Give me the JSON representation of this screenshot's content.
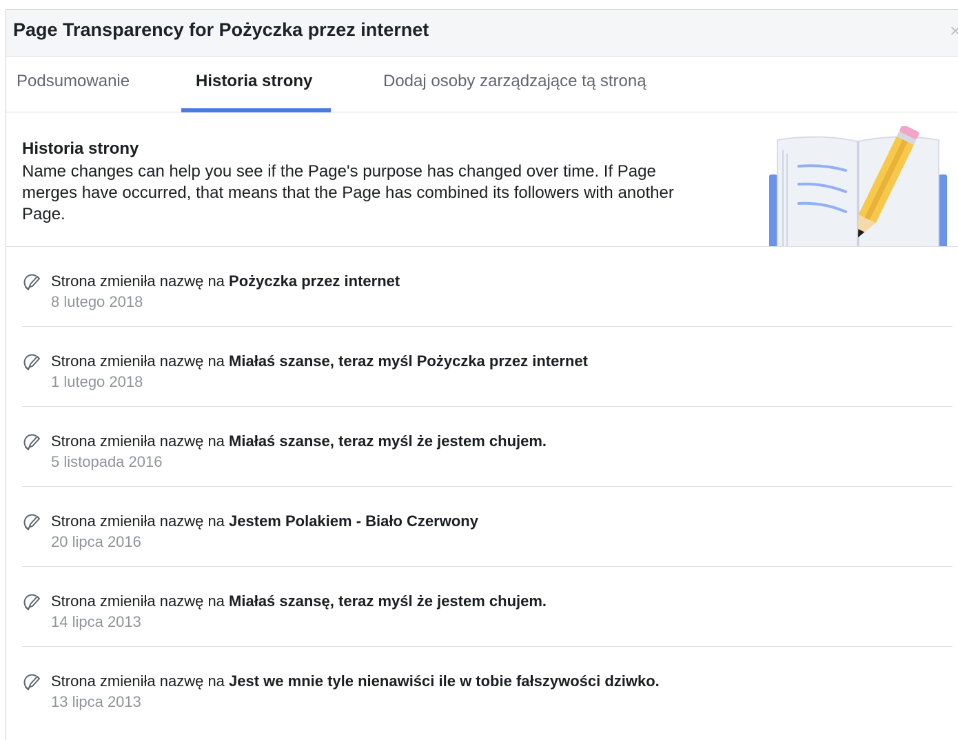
{
  "dialog": {
    "title": "Page Transparency for Pożyczka przez internet",
    "close_symbol": "×"
  },
  "tabs": [
    {
      "label": "Podsumowanie",
      "active": false
    },
    {
      "label": "Historia strony",
      "active": true
    },
    {
      "label": "Dodaj osoby zarządzające tą stroną",
      "active": false
    }
  ],
  "intro": {
    "title": "Historia strony",
    "text": "Name changes can help you see if the Page's purpose has changed over time. If Page merges have occurred, that means that the Page has combined its followers with another Page."
  },
  "history": {
    "prefix": "Strona zmieniła nazwę na ",
    "items": [
      {
        "name": "Pożyczka przez internet",
        "date": "8 lutego 2018"
      },
      {
        "name": "Miałaś szanse, teraz myśl Pożyczka przez internet",
        "date": "1 lutego 2018"
      },
      {
        "name": "Miałaś szanse, teraz myśl że jestem chujem.",
        "date": "5 listopada 2016"
      },
      {
        "name": "Jestem Polakiem - Biało Czerwony",
        "date": "20 lipca 2016"
      },
      {
        "name": "Miałaś szansę, teraz myśl że jestem chujem.",
        "date": "14 lipca 2013"
      },
      {
        "name": "Jest we mnie tyle nienawiści ile w tobie fałszywości dziwko.",
        "date": "13 lipca 2013"
      }
    ]
  },
  "colors": {
    "accent": "#4a7ce0",
    "date_text": "#90949c",
    "header_bg": "#f5f6f7"
  },
  "icons": {
    "close": "close-icon",
    "history_item": "name-change-icon",
    "illustration": "book-pencil-illustration"
  }
}
